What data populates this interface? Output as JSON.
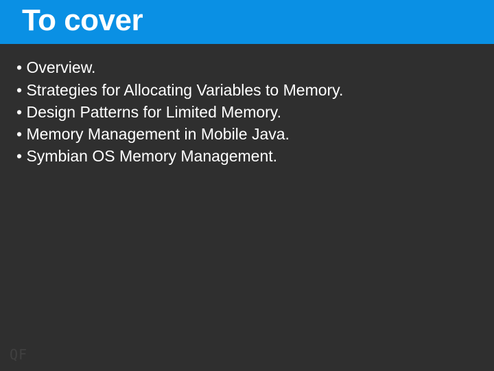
{
  "title": "To cover",
  "bullets": [
    "Overview.",
    "Strategies for Allocating Variables to Memory.",
    "Design Patterns for Limited Memory.",
    "Memory Management in Mobile Java.",
    "Symbian OS Memory Management."
  ],
  "footer_mark": "QF"
}
